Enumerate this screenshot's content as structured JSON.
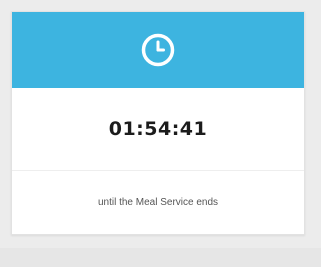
{
  "card": {
    "header_icon": "clock-icon",
    "header_color": "#3db4e0",
    "timer": "01:54:41",
    "caption": "until the Meal Service ends"
  }
}
